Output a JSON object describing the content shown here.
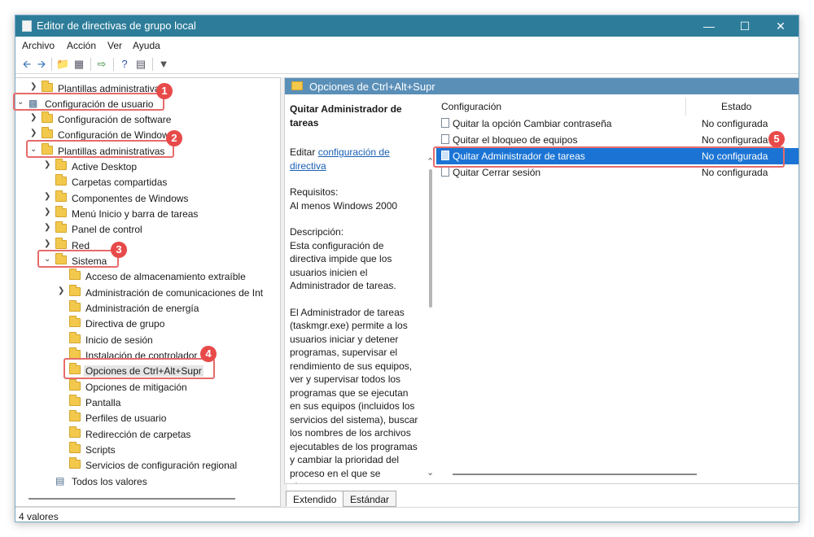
{
  "window": {
    "title": "Editor de directivas de grupo local"
  },
  "menu": [
    "Archivo",
    "Acción",
    "Ver",
    "Ayuda"
  ],
  "tree": [
    {
      "label": "Plantillas administrativas",
      "expanded": false
    },
    {
      "label": "Configuración de usuario",
      "expanded": true
    },
    {
      "label": "Configuración de software",
      "expanded": false
    },
    {
      "label": "Configuración de Windows",
      "expanded": false
    },
    {
      "label": "Plantillas administrativas",
      "expanded": true
    },
    {
      "label": "Active Desktop",
      "expanded": false
    },
    {
      "label": "Carpetas compartidas"
    },
    {
      "label": "Componentes de Windows",
      "expanded": false
    },
    {
      "label": "Menú Inicio y barra de tareas",
      "expanded": false
    },
    {
      "label": "Panel de control",
      "expanded": false
    },
    {
      "label": "Red",
      "expanded": false
    },
    {
      "label": "Sistema",
      "expanded": true
    },
    {
      "label": "Acceso de almacenamiento extraíble"
    },
    {
      "label": "Administración de comunicaciones de Int",
      "expanded": false
    },
    {
      "label": "Administración de energía"
    },
    {
      "label": "Directiva de grupo"
    },
    {
      "label": "Inicio de sesión"
    },
    {
      "label": "Instalación de controlador"
    },
    {
      "label": "Opciones de Ctrl+Alt+Supr"
    },
    {
      "label": "Opciones de mitigación"
    },
    {
      "label": "Pantalla"
    },
    {
      "label": "Perfiles de usuario"
    },
    {
      "label": "Redirección de carpetas"
    },
    {
      "label": "Scripts"
    },
    {
      "label": "Servicios de configuración regional"
    },
    {
      "label": "Todos los valores"
    }
  ],
  "right_header": "Opciones de Ctrl+Alt+Supr",
  "description": {
    "title": "Quitar Administrador de tareas",
    "edit_prefix": "Editar ",
    "edit_link": "configuración de directiva",
    "requirements_label": "Requisitos:",
    "requirements_value": "Al menos Windows 2000",
    "description_label": "Descripción:",
    "paragraph1": "Esta configuración de directiva impide que los usuarios inicien el Administrador de tareas.",
    "paragraph2": "El Administrador de tareas (taskmgr.exe) permite a los usuarios iniciar y detener programas, supervisar el rendimiento de sus equipos, ver y supervisar todos los programas que se ejecutan en sus equipos (incluidos los servicios del sistema), buscar los nombres de los archivos ejecutables de los programas y cambiar la prioridad del proceso en el que se ejecutan"
  },
  "list": {
    "col_setting": "Configuración",
    "col_state": "Estado",
    "rows": [
      {
        "name": "Quitar la opción Cambiar contraseña",
        "state": "No configurada"
      },
      {
        "name": "Quitar el bloqueo de equipos",
        "state": "No configurada"
      },
      {
        "name": "Quitar Administrador de tareas",
        "state": "No configurada"
      },
      {
        "name": "Quitar Cerrar sesión",
        "state": "No configurada"
      }
    ]
  },
  "tabs": [
    "Extendido",
    "Estándar"
  ],
  "status": "4 valores",
  "callouts": [
    "1",
    "2",
    "3",
    "4",
    "5"
  ],
  "colors": {
    "titlebar": "#2d7d9a",
    "selection": "#1b74d4",
    "callout": "#e84a4a"
  }
}
